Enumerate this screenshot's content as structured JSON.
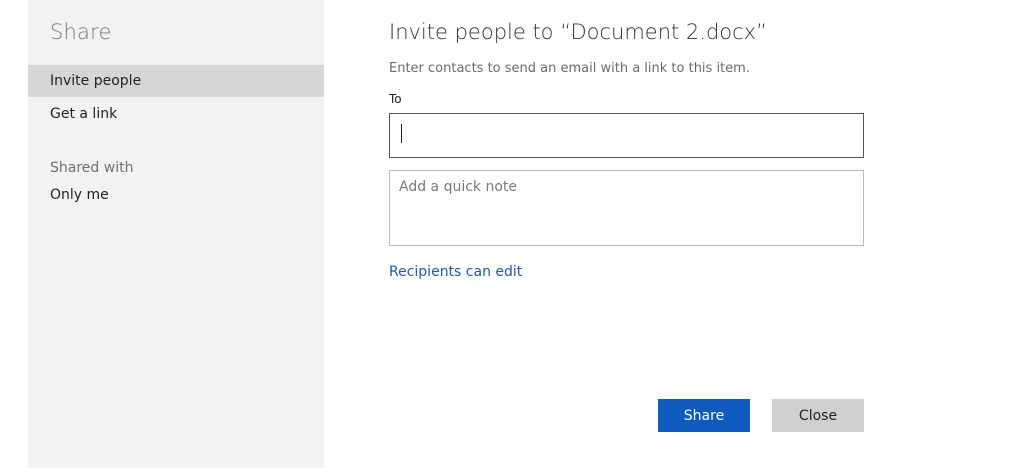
{
  "sidebar": {
    "title": "Share",
    "items": [
      {
        "label": "Invite people",
        "active": true
      },
      {
        "label": "Get a link",
        "active": false
      }
    ],
    "shared_with": {
      "heading": "Shared with",
      "value": "Only me"
    }
  },
  "main": {
    "title": "Invite people to “Document 2.docx”",
    "description": "Enter contacts to send an email with a link to this item.",
    "to_label": "To",
    "to_value": "",
    "note_placeholder": "Add a quick note",
    "permissions_link": "Recipients can edit"
  },
  "buttons": {
    "share": "Share",
    "close": "Close"
  },
  "colors": {
    "sidebar_bg": "#f2f2f2",
    "active_item_bg": "#d6d6d6",
    "accent": "#0f5bbd",
    "link": "#1a5ab8",
    "secondary_button": "#d0d0d0"
  }
}
